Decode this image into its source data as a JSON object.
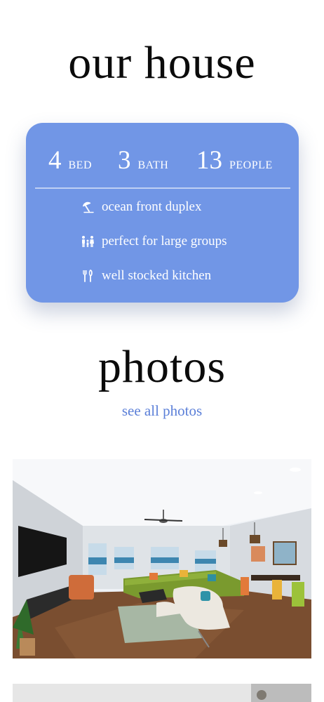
{
  "house": {
    "title": "our house",
    "stats": [
      {
        "number": "4",
        "label": "BED"
      },
      {
        "number": "3",
        "label": "BATH"
      },
      {
        "number": "13",
        "label": "PEOPLE"
      }
    ],
    "features": [
      {
        "icon": "umbrella-beach-icon",
        "text": "ocean front duplex"
      },
      {
        "icon": "family-icon",
        "text": "perfect for large groups"
      },
      {
        "icon": "utensils-icon",
        "text": "well stocked kitchen"
      }
    ]
  },
  "photos": {
    "title": "photos",
    "see_all_label": "see all photos"
  },
  "colors": {
    "card_bg": "#7196e6",
    "link": "#5b7fd8",
    "text": "#0b0b0b"
  }
}
